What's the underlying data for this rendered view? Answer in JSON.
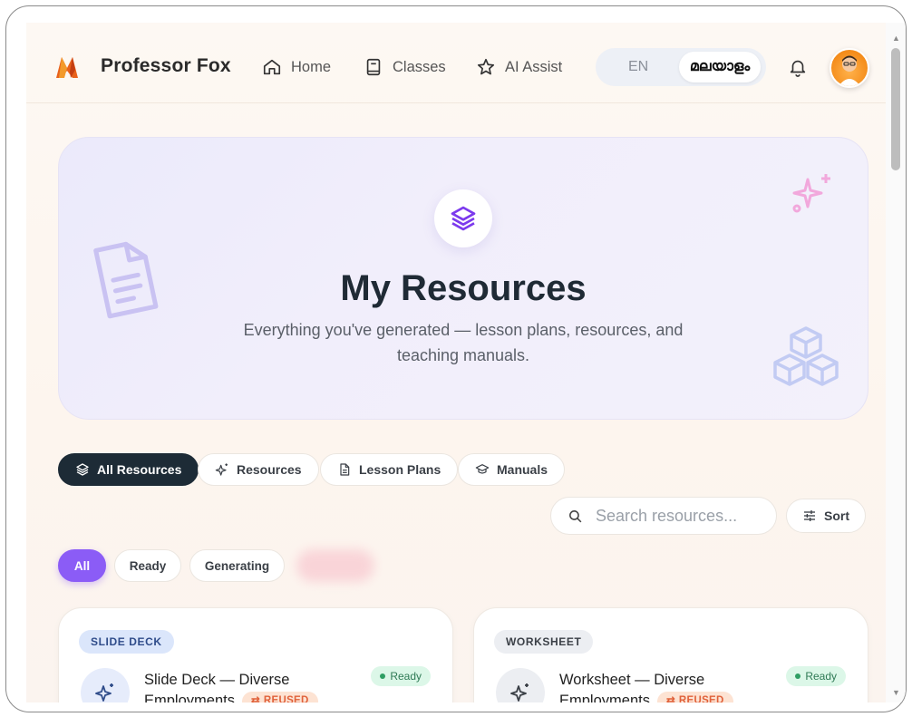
{
  "header": {
    "brand": "Professor Fox",
    "nav": [
      {
        "label": "Home",
        "icon": "home-icon"
      },
      {
        "label": "Classes",
        "icon": "book-icon"
      },
      {
        "label": "AI Assist",
        "icon": "star-icon"
      }
    ],
    "language": {
      "en": "EN",
      "ml": "മലയാളം",
      "selected": "മലയാളം"
    }
  },
  "hero": {
    "title": "My Resources",
    "subtitle": "Everything you've generated — lesson plans, resources, and teaching manuals."
  },
  "tabs": [
    {
      "label": "All Resources",
      "icon": "layers-icon",
      "active": true
    },
    {
      "label": "Resources",
      "icon": "sparkles-icon",
      "active": false
    },
    {
      "label": "Lesson Plans",
      "icon": "document-icon",
      "active": false
    },
    {
      "label": "Manuals",
      "icon": "graduation-cap-icon",
      "active": false
    }
  ],
  "search": {
    "placeholder": "Search resources..."
  },
  "sort": {
    "label": "Sort"
  },
  "filters": [
    {
      "label": "All",
      "active": true
    },
    {
      "label": "Ready",
      "active": false
    },
    {
      "label": "Generating",
      "active": false
    }
  ],
  "cards": [
    {
      "type": "SLIDE DECK",
      "title": "Slide Deck — Diverse Employments",
      "badge": "REUSED",
      "status": "Ready"
    },
    {
      "type": "WORKSHEET",
      "title": "Worksheet — Diverse Employments",
      "badge": "REUSED",
      "status": "Ready"
    }
  ],
  "colors": {
    "accent": "#8b5cf6",
    "dark": "#1d2b36",
    "ready": "#2f9e63",
    "reused": "#e0613a"
  }
}
